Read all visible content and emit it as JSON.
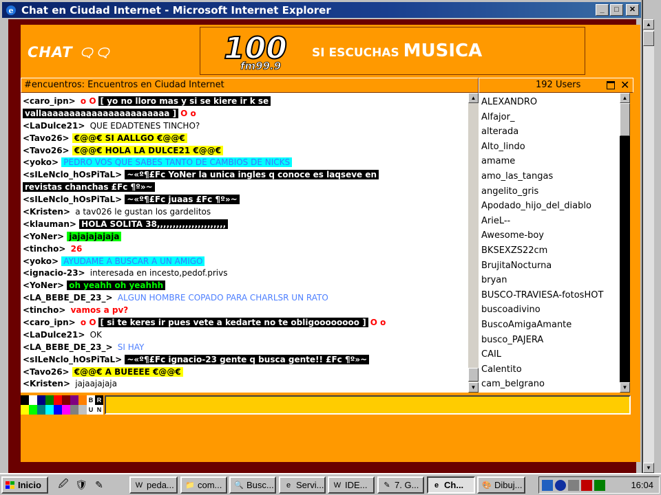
{
  "window": {
    "title": "Chat en Ciudad Internet - Microsoft Internet Explorer"
  },
  "header": {
    "chat_logo": "CHAT",
    "banner_slogan_small": "SI ESCUCHAS",
    "banner_slogan_big": "MUSICA",
    "banner_station": "fm99.9",
    "banner_number": "100"
  },
  "channel": {
    "topic": "#encuentros: Encuentros en Ciudad Internet",
    "users_count": "192 Users"
  },
  "messages": [
    {
      "nick": "<caro_ipn>",
      "parts": [
        {
          "s": "red",
          "t": "o O"
        },
        {
          "s": "inv",
          "t": "[ yo no lloro mas y si se kiere ir k se"
        }
      ]
    },
    {
      "nick": "",
      "parts": [
        {
          "s": "inv",
          "t": "vallaaaaaaaaaaaaaaaaaaaaaaa ]"
        },
        {
          "s": "red",
          "t": "O o"
        }
      ]
    },
    {
      "nick": "<LaDulce21>",
      "parts": [
        {
          "s": "plain",
          "t": "QUE EDADTENES TINCHO?"
        }
      ]
    },
    {
      "nick": "<Tavo26>",
      "parts": [
        {
          "s": "yel",
          "t": "€@@€ SI AALLGO €@@€"
        }
      ]
    },
    {
      "nick": "<Tavo26>",
      "parts": [
        {
          "s": "yel",
          "t": "€@@€ HOLA LA DULCE21 €@@€"
        }
      ]
    },
    {
      "nick": "<yoko>",
      "parts": [
        {
          "s": "cyan",
          "t": "PEDRO VOS QUE SABES TANTO DE CAMBIOS DE NICKS"
        }
      ]
    },
    {
      "nick": "<sILeNclo_hOsPiTaL>",
      "parts": [
        {
          "s": "inv",
          "t": "~«º¶£Fc YoNer la unica ingles q conoce es laqseve en"
        }
      ]
    },
    {
      "nick": "",
      "parts": [
        {
          "s": "inv",
          "t": "revistas chanchas £Fc ¶º»~"
        }
      ]
    },
    {
      "nick": "<sILeNclo_hOsPiTaL>",
      "parts": [
        {
          "s": "inv",
          "t": "~«º¶£Fc juaas £Fc ¶º»~"
        }
      ]
    },
    {
      "nick": "<Kristen>",
      "parts": [
        {
          "s": "plain",
          "t": "a tav026 le gustan los gardelitos"
        }
      ]
    },
    {
      "nick": "<klauman>",
      "parts": [
        {
          "s": "inv",
          "t": "HOLA SOLITA 38,,,,,,,,,,,,,,,,,,,,,,"
        }
      ]
    },
    {
      "nick": "<YoNer>",
      "parts": [
        {
          "s": "green",
          "t": "jajajajajaja"
        }
      ]
    },
    {
      "nick": "<tincho>",
      "parts": [
        {
          "s": "red",
          "t": "26"
        }
      ]
    },
    {
      "nick": "<yoko>",
      "parts": [
        {
          "s": "cyan",
          "t": "AYUDAME A BUSCAR A UN AMIGO"
        }
      ]
    },
    {
      "nick": "<ignacio-23>",
      "parts": [
        {
          "s": "plain",
          "t": "interesada en incesto,pedof.privs"
        }
      ]
    },
    {
      "nick": "<YoNer>",
      "parts": [
        {
          "s": "greenbg",
          "t": "oh yeahh oh yeahhh"
        }
      ]
    },
    {
      "nick": "<LA_BEBE_DE_23_>",
      "parts": [
        {
          "s": "blue",
          "t": "ALGUN HOMBRE COPADO PARA CHARLSR UN RATO"
        }
      ]
    },
    {
      "nick": "<tincho>",
      "parts": [
        {
          "s": "red",
          "t": "vamos a pv?"
        }
      ]
    },
    {
      "nick": "<caro_ipn>",
      "parts": [
        {
          "s": "red",
          "t": "o O"
        },
        {
          "s": "inv",
          "t": "[ si te keres ir pues vete a kedarte no te obligoooooooo ]"
        },
        {
          "s": "red",
          "t": "O o"
        }
      ]
    },
    {
      "nick": "<LaDulce21>",
      "parts": [
        {
          "s": "plain",
          "t": "OK"
        }
      ]
    },
    {
      "nick": "<LA_BEBE_DE_23_>",
      "parts": [
        {
          "s": "blue",
          "t": "SI HAY"
        }
      ]
    },
    {
      "nick": "<sILeNclo_hOsPiTaL>",
      "parts": [
        {
          "s": "inv",
          "t": "~«º¶£Fc ignacio-23 gente q busca gente!! £Fc ¶º»~"
        }
      ]
    },
    {
      "nick": "<Tavo26>",
      "parts": [
        {
          "s": "yel",
          "t": "€@@€ A BUEEEE €@@€"
        }
      ]
    },
    {
      "nick": "<Kristen>",
      "parts": [
        {
          "s": "plain",
          "t": "jajaajajaja"
        }
      ]
    }
  ],
  "users": [
    "ALEXANDRO",
    "Alfajor_",
    "alterada",
    "Alto_lindo",
    "amame",
    "amo_las_tangas",
    "angelito_gris",
    "Apodado_hijo_del_diablo",
    "ArieL--",
    "Awesome-boy",
    "BKSEXZS22cm",
    "BrujitaNocturna",
    "bryan",
    "BUSCO-TRAVIESA-fotosHOT",
    "buscoadivino",
    "BuscoAmigaAmante",
    "busco_PAJERA",
    "CAIL",
    "Calentito",
    "cam_belgrano"
  ],
  "palette": {
    "colors": [
      "#000000",
      "#ffffff",
      "#000080",
      "#008000",
      "#ff0000",
      "#800000",
      "#800080",
      "#ff8000",
      "#ffff00",
      "#00ff00",
      "#008080",
      "#00ffff",
      "#0000ff",
      "#ff00ff",
      "#808080",
      "#c0c0c0"
    ],
    "format": [
      "B",
      "R",
      "U",
      "N"
    ]
  },
  "taskbar": {
    "start_label": "Inicio",
    "tasks": [
      "peda...",
      "com...",
      "Busc...",
      "Servi...",
      "IDE...",
      "7. G...",
      "Ch...",
      "Dibuj..."
    ],
    "clock": "16:04"
  }
}
